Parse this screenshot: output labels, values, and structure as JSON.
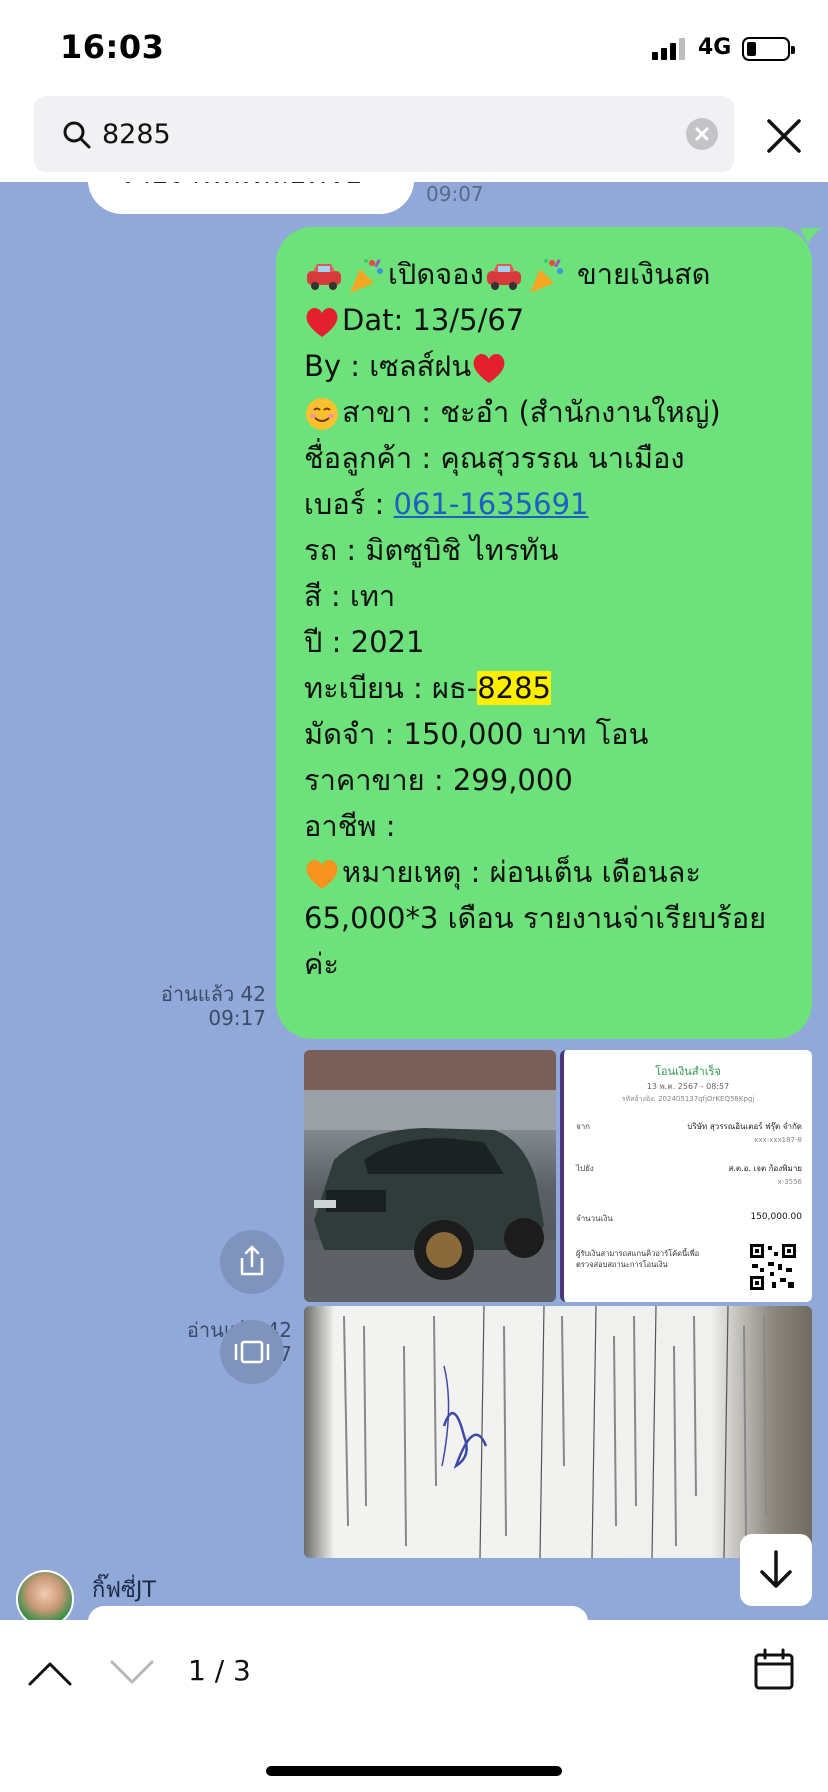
{
  "status_bar": {
    "time": "16:03",
    "network": "4G"
  },
  "search": {
    "query": "8285",
    "placeholder": ""
  },
  "previous_message": {
    "text": "รายงานที่เหลือครับ",
    "time": "09:07"
  },
  "message": {
    "lines": {
      "l1": "เปิดจอง",
      "l1b": "ขายเงินสด",
      "l2": "Dat: 13/5/67",
      "l3": "By : เซลส์ฝน",
      "l4": "สาขา : ชะอำ (สำนักงานใหญ่)",
      "l5": "ชื่อลูกค้า : คุณสุวรรณ นาเมือง",
      "l6_label": "เบอร์ : ",
      "l6_phone": "061-1635691",
      "l7": "รถ : มิตซูบิชิ ไทรทัน",
      "l8": "สี : เทา",
      "l9": "ปี : 2021",
      "l10_label": "ทะเบียน : ผธ-",
      "l10_hl": "8285",
      "l11": "มัดจำ : 150,000 บาท โอน",
      "l12": "ราคาขาย : 299,000",
      "l13": "อาชีพ :",
      "l14": "หมายเหตุ : ผ่อนเต็น เดือนละ 65,000*3 เดือน รายงานจ่าเรียบร้อยค่ะ"
    },
    "read": "อ่านแล้ว 42",
    "time": "09:17"
  },
  "photos_meta": {
    "read": "อ่านแล้ว 42",
    "time": "09:17"
  },
  "slip": {
    "status": "โอนเงินสำเร็จ",
    "date": "13 พ.ค. 2567 - 08:57",
    "ref": "รหัสอ้างอิง: 202405137qfjOrKEQ58Kpgj",
    "from_label": "จาก",
    "from_name": "บริษัท สุวรรณอินเตอร์ ฟรุ๊ต จำกัด",
    "from_acct": "xxx-xxx187-8",
    "to_label": "ไปยัง",
    "to_name": "ส.ต.อ. เจต ก้องพิมาย",
    "to_acct": "x-3556",
    "amount_label": "จำนวนเงิน",
    "amount": "150,000.00",
    "note": "ผู้รับเงินสามารถสแกนคิวอาร์โค้ดนี้เพื่อตรวจสอบสถานะการโอนเงิน"
  },
  "next_message": {
    "sender": "กิ๊ฟซี่JT"
  },
  "bottom": {
    "counter": "1 / 3"
  },
  "colors": {
    "chat_bg": "#90a9d8",
    "bubble": "#6de27a",
    "link": "#1d5fc4",
    "highlight": "#ffee00"
  },
  "icons": [
    "search-icon",
    "clear-icon",
    "close-icon",
    "share-icon",
    "album-icon",
    "arrow-down-icon",
    "chevron-up-icon",
    "chevron-down-icon",
    "calendar-icon"
  ]
}
